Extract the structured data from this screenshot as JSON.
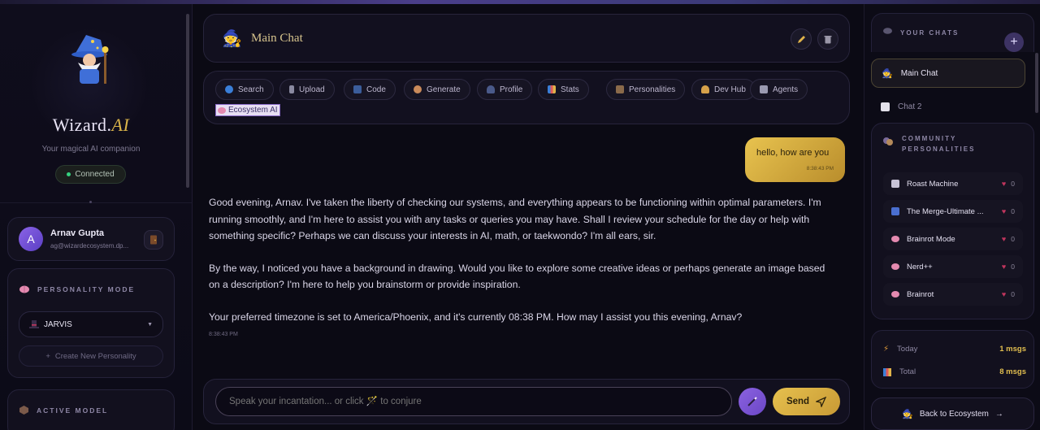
{
  "app": {
    "name": "Wizard",
    "name_suffix": "AI",
    "tagline": "Your magical AI companion",
    "status": "Connected"
  },
  "user": {
    "initial": "A",
    "name": "Arnav Gupta",
    "email": "ag@wizardecosystem.dp..."
  },
  "personality_mode": {
    "title": "PERSONALITY MODE",
    "selected": "JARVIS",
    "create_label": "Create New Personality"
  },
  "active_model": {
    "title": "ACTIVE MODEL"
  },
  "chat": {
    "title": "Main Chat",
    "tools": [
      "Search",
      "Upload",
      "Code",
      "Generate",
      "Profile",
      "Stats",
      "Personalities",
      "Dev Hub",
      "Agents"
    ],
    "ecosystem_tool": "Ecosystem AI",
    "user_message": "hello, how are you",
    "user_time": "8:38:43 PM",
    "ai_paragraphs": [
      "Good evening, Arnav. I've taken the liberty of checking our systems, and everything appears to be functioning within optimal parameters. I'm running smoothly, and I'm here to assist you with any tasks or queries you may have. Shall I review your schedule for the day or help with something specific? Perhaps we can discuss your interests in AI, math, or taekwondo? I'm all ears, sir.",
      "By the way, I noticed you have a background in drawing. Would you like to explore some creative ideas or perhaps generate an image based on a description? I'm here to help you brainstorm or provide inspiration.",
      "Your preferred timezone is set to America/Phoenix, and it's currently 08:38 PM. How may I assist you this evening, Arnav?"
    ],
    "ai_time": "8:38:43 PM",
    "input_placeholder": "Speak your incantation... or click 🪄 to conjure",
    "send_label": "Send"
  },
  "right": {
    "your_chats_title": "YOUR CHATS",
    "chats": [
      "Main Chat",
      "Chat 2"
    ],
    "community_title": "COMMUNITY PERSONALITIES",
    "personalities": [
      {
        "name": "Roast Machine",
        "likes": "0"
      },
      {
        "name": "The Merge-Ultimate ...",
        "likes": "0"
      },
      {
        "name": "Brainrot Mode",
        "likes": "0"
      },
      {
        "name": "Nerd++",
        "likes": "0"
      },
      {
        "name": "Brainrot",
        "likes": "0"
      }
    ],
    "stats": [
      {
        "label": "Today",
        "value": "1 msgs"
      },
      {
        "label": "Total",
        "value": "8 msgs"
      }
    ],
    "back_label": "Back to Ecosystem"
  },
  "colors": {
    "accent_gold": "#e1be4f",
    "accent_purple": "#8b62e0",
    "status_green": "#35d07f"
  }
}
